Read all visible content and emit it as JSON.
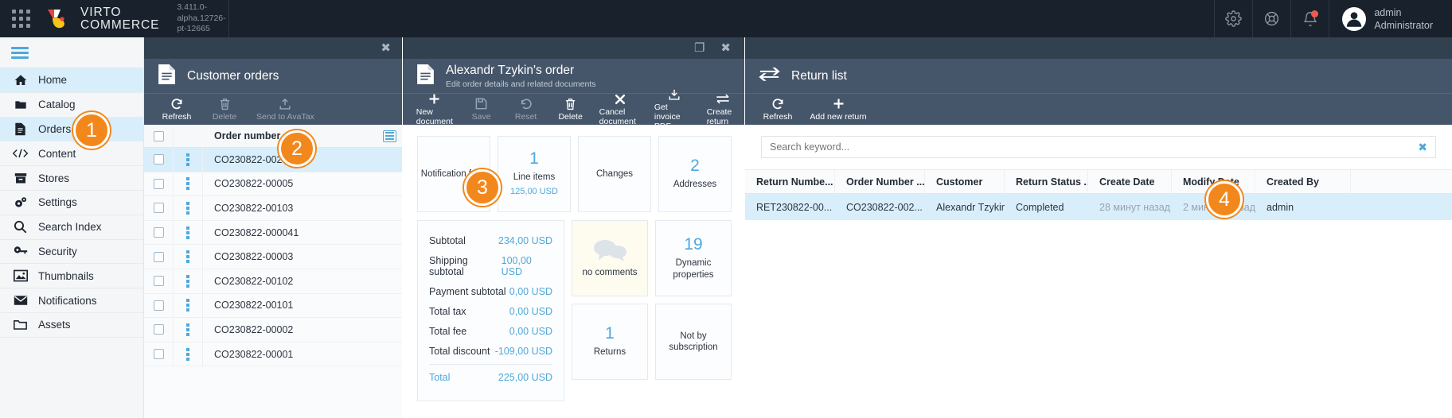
{
  "topbar": {
    "apps_icon": "apps-grid-icon",
    "brand_line1": "VIRTO",
    "brand_line2": "COMMERCE",
    "version": "3.411.0-alpha.12726-pt-12665",
    "icons": [
      "gear-icon",
      "lifebuoy-icon",
      "bell-icon"
    ],
    "user_name": "admin",
    "user_role": "Administrator"
  },
  "sidebar": {
    "items": [
      {
        "label": "Home",
        "icon": "home-icon",
        "active": false
      },
      {
        "label": "Catalog",
        "icon": "folder-icon",
        "active": false
      },
      {
        "label": "Orders",
        "icon": "document-icon",
        "active": true
      },
      {
        "label": "Content",
        "icon": "code-icon",
        "active": false
      },
      {
        "label": "Stores",
        "icon": "store-icon",
        "active": false
      },
      {
        "label": "Settings",
        "icon": "gears-icon",
        "active": false
      },
      {
        "label": "Search Index",
        "icon": "magnifier-icon",
        "active": false
      },
      {
        "label": "Security",
        "icon": "key-icon",
        "active": false
      },
      {
        "label": "Thumbnails",
        "icon": "image-icon",
        "active": false
      },
      {
        "label": "Notifications",
        "icon": "envelope-icon",
        "active": false
      },
      {
        "label": "Assets",
        "icon": "folder-outline-icon",
        "active": false
      }
    ]
  },
  "orders_blade": {
    "title": "Customer orders",
    "close_label": "✖",
    "toolbar": [
      {
        "label": "Refresh",
        "icon": "refresh-icon",
        "disabled": false
      },
      {
        "label": "Delete",
        "icon": "trash-icon",
        "disabled": true
      },
      {
        "label": "Send to AvaTax",
        "icon": "upload-icon",
        "disabled": true
      }
    ],
    "column_header": "Order number",
    "rows": [
      {
        "order_number": "CO230822-00201",
        "selected": true
      },
      {
        "order_number": "CO230822-00005",
        "selected": false
      },
      {
        "order_number": "CO230822-00103",
        "selected": false
      },
      {
        "order_number": "CO230822-000041",
        "selected": false
      },
      {
        "order_number": "CO230822-00003",
        "selected": false
      },
      {
        "order_number": "CO230822-00102",
        "selected": false
      },
      {
        "order_number": "CO230822-00101",
        "selected": false
      },
      {
        "order_number": "CO230822-00002",
        "selected": false
      },
      {
        "order_number": "CO230822-00001",
        "selected": false
      }
    ]
  },
  "detail_blade": {
    "title": "Alexandr Tzykin's order",
    "subtitle": "Edit order details and related documents",
    "maximize_label": "❐",
    "close_label": "✖",
    "toolbar": [
      {
        "label": "New document",
        "icon": "plus-icon",
        "disabled": false
      },
      {
        "label": "Save",
        "icon": "save-icon",
        "disabled": true
      },
      {
        "label": "Reset",
        "icon": "undo-icon",
        "disabled": true
      },
      {
        "label": "Delete",
        "icon": "trash-icon",
        "disabled": false
      },
      {
        "label": "Cancel document",
        "icon": "x-icon",
        "disabled": false
      },
      {
        "label": "Get invoice PDF",
        "icon": "download-icon",
        "disabled": false
      },
      {
        "label": "Create return",
        "icon": "exchange-icon",
        "disabled": false
      }
    ],
    "widgets_row1": [
      {
        "big": "",
        "label": "Notification feed",
        "sub": ""
      },
      {
        "big": "1",
        "label": "Line items",
        "sub": "125,00 USD"
      },
      {
        "big": "",
        "label": "Changes",
        "sub": ""
      },
      {
        "big": "2",
        "label": "Addresses",
        "sub": ""
      }
    ],
    "totals": [
      {
        "label": "Subtotal",
        "value": "234,00 USD"
      },
      {
        "label": "Shipping subtotal",
        "value": "100,00 USD"
      },
      {
        "label": "Payment subtotal",
        "value": "0,00 USD"
      },
      {
        "label": "Total tax",
        "value": "0,00 USD"
      },
      {
        "label": "Total fee",
        "value": "0,00 USD"
      },
      {
        "label": "Total discount",
        "value": "-109,00 USD"
      }
    ],
    "grand_total": {
      "label": "Total",
      "value": "225,00 USD"
    },
    "widgets_col2": [
      {
        "big": "",
        "label": "no comments",
        "sub": "",
        "cream": true
      },
      {
        "big": "1",
        "label": "Returns",
        "sub": ""
      }
    ],
    "widgets_col3": [
      {
        "big": "19",
        "label": "Dynamic properties",
        "sub": ""
      },
      {
        "big": "",
        "label": "Not by subscription",
        "sub": ""
      }
    ]
  },
  "return_blade": {
    "title": "Return list",
    "toolbar": [
      {
        "label": "Refresh",
        "icon": "refresh-icon",
        "disabled": false
      },
      {
        "label": "Add new return",
        "icon": "plus-icon",
        "disabled": false
      }
    ],
    "search": {
      "value": "",
      "placeholder": "Search keyword...",
      "clear_label": "✖"
    },
    "columns": [
      "Return Numbe...",
      "Order Number ...",
      "Customer",
      "Return Status ...",
      "Create Date",
      "Modify Date",
      "Created By"
    ],
    "rows": [
      {
        "return_number": "RET230822-00...",
        "order_number": "CO230822-002...",
        "customer": "Alexandr Tzykin",
        "status": "Completed",
        "create_date": "28 минут назад",
        "modify_date": "2 минуты назад",
        "created_by": "admin"
      }
    ]
  },
  "callouts": [
    {
      "number": "1"
    },
    {
      "number": "2"
    },
    {
      "number": "3"
    },
    {
      "number": "4"
    }
  ],
  "colors": {
    "accent_orange": "#f2881c",
    "accent_blue": "#4fa8dc",
    "header_dark": "#19212c",
    "blade_header": "#46566a",
    "selection": "#d9eefb"
  }
}
